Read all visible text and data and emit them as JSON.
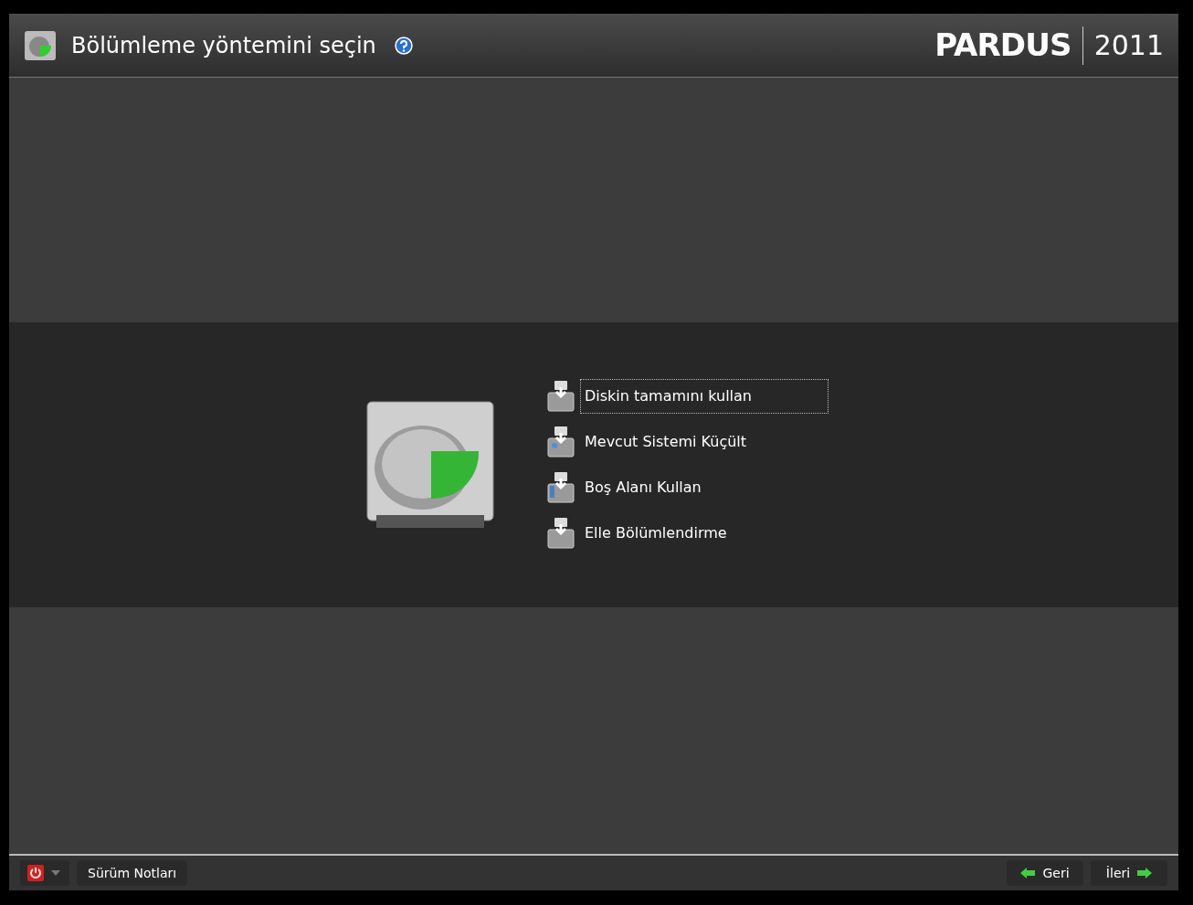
{
  "header": {
    "title": "Bölümleme yöntemini seçin",
    "brand": "PARDUS",
    "year": "2011"
  },
  "options": [
    {
      "label": "Diskin tamamını kullan",
      "selected": true,
      "kind": "plain"
    },
    {
      "label": "Mevcut Sistemi Küçült",
      "selected": false,
      "kind": "shrink"
    },
    {
      "label": "Boş Alanı Kullan",
      "selected": false,
      "kind": "free"
    },
    {
      "label": "Elle Bölümlendirme",
      "selected": false,
      "kind": "plain"
    }
  ],
  "footer": {
    "release_notes": "Sürüm Notları",
    "back": "Geri",
    "next": "İleri"
  }
}
